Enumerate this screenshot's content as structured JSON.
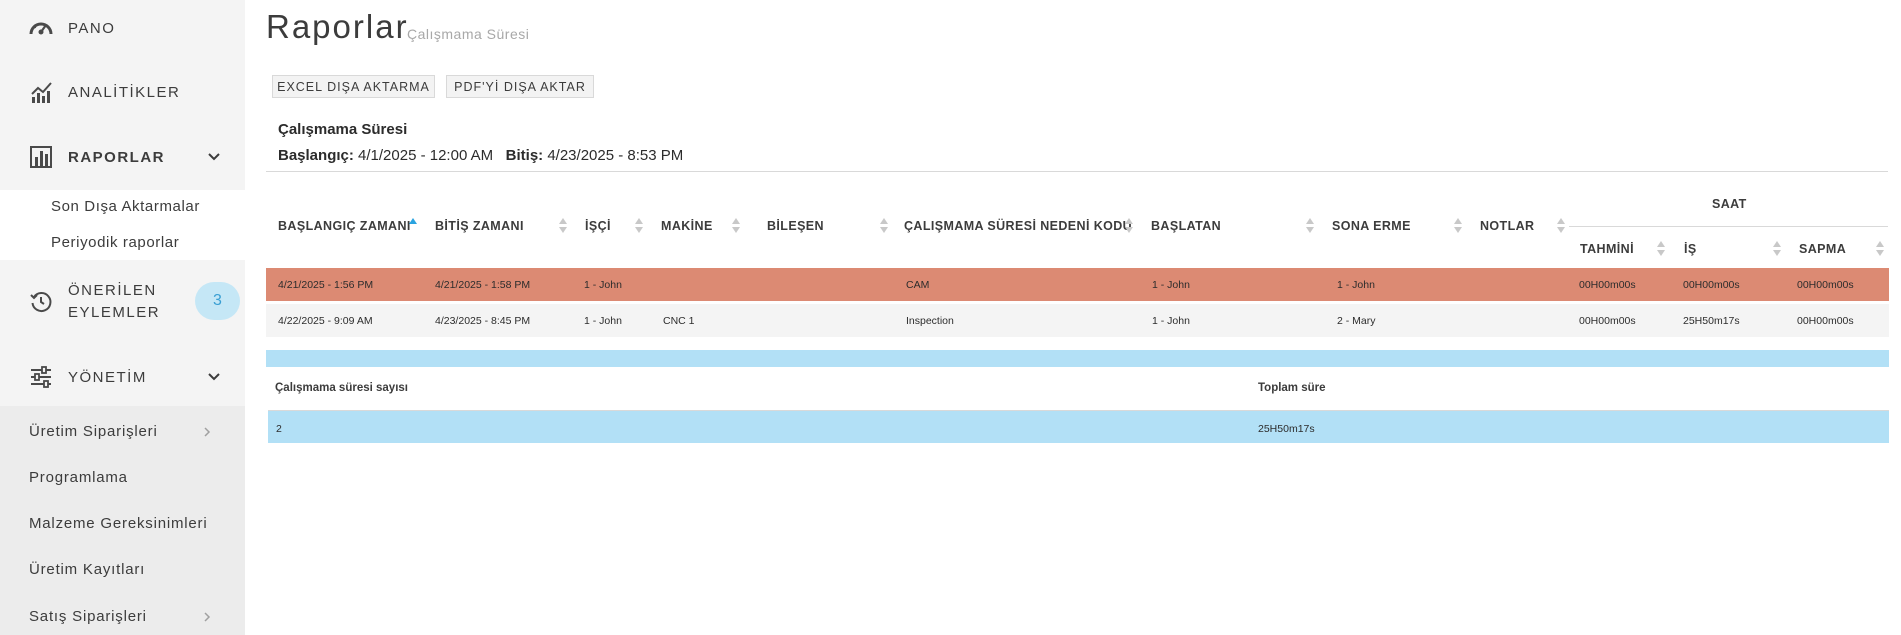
{
  "sidebar": {
    "pano": "PANO",
    "analitikler": "ANALİTİKLER",
    "raporlar": "RAPORLAR",
    "son_disa": "Son Dışa Aktarmalar",
    "periyodik": "Periyodik raporlar",
    "onerilen_1": "ÖNERİLEN",
    "onerilen_2": "EYLEMLER",
    "onerilen_count": "3",
    "yonetim": "YÖNETİM",
    "uretim_siparisleri": "Üretim Siparişleri",
    "programlama": "Programlama",
    "malzeme": "Malzeme Gereksinimleri",
    "uretim_kayitlari": "Üretim Kayıtları",
    "satis": "Satış Siparişleri"
  },
  "header": {
    "title": "Raporlar",
    "subtitle": "Çalışmama Süresi",
    "excel_button": "EXCEL DIŞA AKTARMA",
    "pdf_button": "PDF'Yİ DIŞA AKTAR"
  },
  "report": {
    "name": "Çalışmama Süresi",
    "start_label": "Başlangıç:",
    "start_value": "4/1/2025 - 12:00 AM",
    "end_label": "Bitiş:",
    "end_value": "4/23/2025 - 8:53 PM"
  },
  "table": {
    "group_header": "SAAT",
    "columns": {
      "start": "BAŞLANGIÇ ZAMANI",
      "end": "BİTİŞ ZAMANI",
      "worker": "İŞÇİ",
      "machine": "MAKİNE",
      "component": "BİLEŞEN",
      "reason": "ÇALIŞMAMA SÜRESİ NEDENİ KODU",
      "started_by": "BAŞLATAN",
      "ended_by": "SONA ERME",
      "notes": "NOTLAR",
      "estimated": "TAHMİNİ",
      "work": "İŞ",
      "variance": "SAPMA"
    },
    "rows": [
      {
        "start": "4/21/2025 - 1:56 PM",
        "end": "4/21/2025 - 1:58 PM",
        "worker": "1 - John",
        "machine": "",
        "component": "",
        "reason": "CAM",
        "started_by": "1 - John",
        "ended_by": "1 - John",
        "notes": "",
        "estimated": "00H00m00s",
        "work": "00H00m00s",
        "variance": "00H00m00s"
      },
      {
        "start": "4/22/2025 - 9:09 AM",
        "end": "4/23/2025 - 8:45 PM",
        "worker": "1 - John",
        "machine": "CNC 1",
        "component": "",
        "reason": "Inspection",
        "started_by": "1 - John",
        "ended_by": "2 - Mary",
        "notes": "",
        "estimated": "00H00m00s",
        "work": "25H50m17s",
        "variance": "00H00m00s"
      }
    ]
  },
  "summary": {
    "count_label": "Çalışmama süresi sayısı",
    "total_label": "Toplam süre",
    "count_value": "2",
    "total_value": "25H50m17s"
  },
  "colors": {
    "highlight_row": "#dc8a73",
    "summary_blue": "#b2e0f6",
    "badge_bg": "#c5e7f6",
    "sort_active": "#2aa3e0"
  },
  "icons": {
    "pano": "speedometer-icon",
    "analitikler": "line-chart-icon",
    "raporlar": "bar-chart-icon",
    "onerilen": "history-icon",
    "yonetim": "sliders-icon"
  }
}
